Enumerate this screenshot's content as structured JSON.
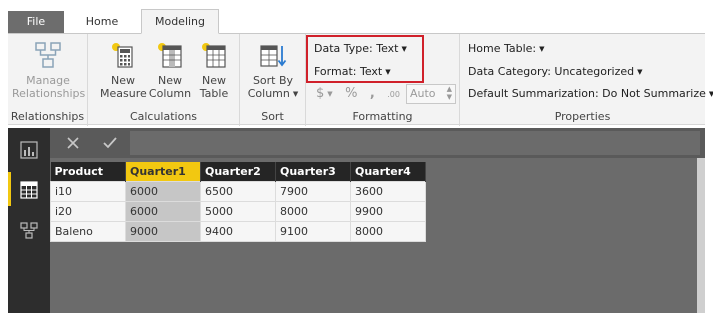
{
  "tabs": {
    "file": "File",
    "home": "Home",
    "modeling": "Modeling"
  },
  "ribbon": {
    "relationships": {
      "manage_line1": "Manage",
      "manage_line2": "Relationships",
      "group_label": "Relationships"
    },
    "calculations": {
      "new_measure_1": "New",
      "new_measure_2": "Measure",
      "new_column_1": "New",
      "new_column_2": "Column",
      "new_table_1": "New",
      "new_table_2": "Table",
      "group_label": "Calculations"
    },
    "sort": {
      "line1": "Sort By",
      "line2": "Column",
      "group_label": "Sort"
    },
    "formatting": {
      "data_type": "Data Type: Text",
      "format": "Format: Text",
      "currency": "$",
      "percent": "%",
      "comma": ",",
      "decimal": ".00",
      "auto": "Auto",
      "group_label": "Formatting",
      "highlight_color": "#d0202a"
    },
    "properties": {
      "home_table": "Home Table:",
      "data_category": "Data Category: Uncategorized",
      "default_summarization": "Default Summarization: Do Not Summarize",
      "group_label": "Properties"
    }
  },
  "formula": {
    "cancel_icon": "close-icon",
    "commit_icon": "check-icon"
  },
  "table": {
    "headers": [
      "Product",
      "Quarter1",
      "Quarter2",
      "Quarter3",
      "Quarter4"
    ],
    "selected_column": "Quarter1",
    "rows": [
      [
        "i10",
        "6000",
        "6500",
        "7900",
        "3600"
      ],
      [
        "i20",
        "6000",
        "5000",
        "8000",
        "9900"
      ],
      [
        "Baleno",
        "9000",
        "9400",
        "9100",
        "8000"
      ]
    ]
  },
  "colors": {
    "accent": "#f2c811",
    "sidebar": "#2d2d2d",
    "canvas": "#6b6b6b"
  }
}
